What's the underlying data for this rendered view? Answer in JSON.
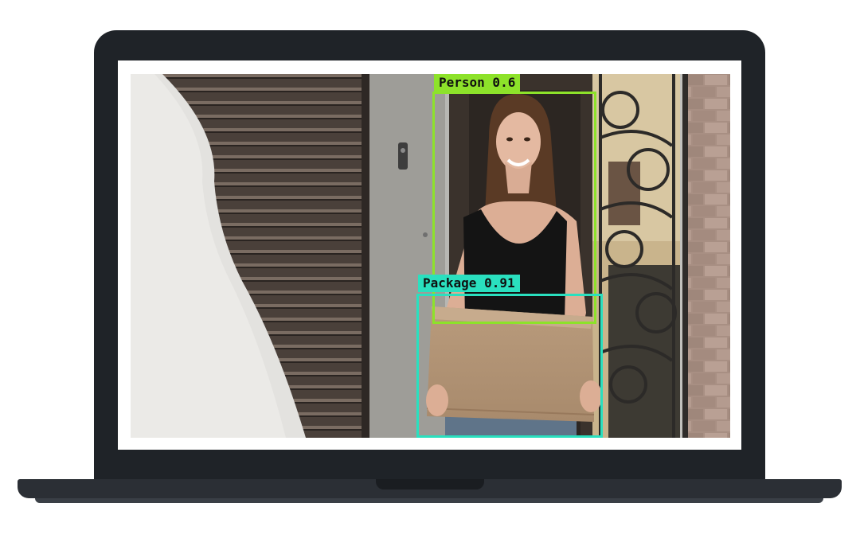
{
  "detections": {
    "person": {
      "label": "Person 0.6",
      "color": "#8de22a"
    },
    "package": {
      "label": "Package 0.91",
      "color": "#2ae0bf"
    }
  },
  "device": {
    "type": "laptop",
    "bezel_color": "#1f2328"
  }
}
